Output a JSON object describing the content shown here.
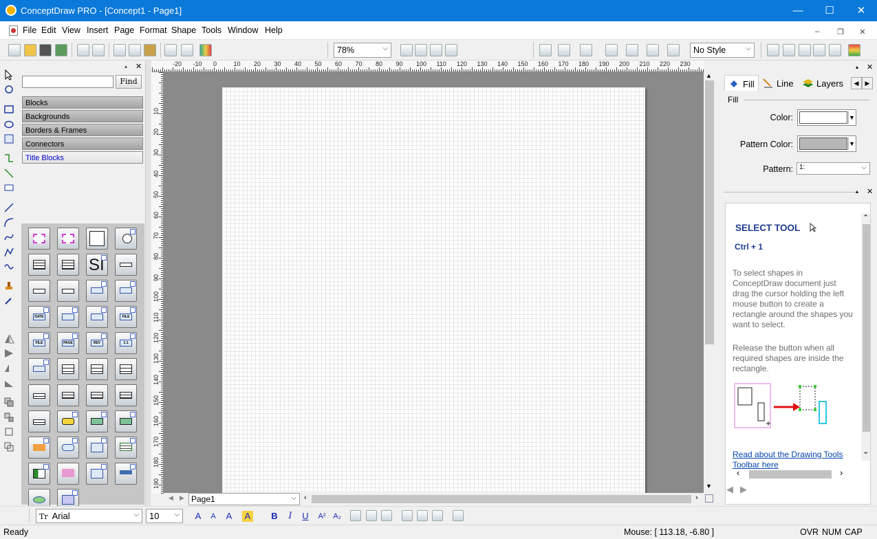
{
  "window": {
    "title": "ConceptDraw PRO - [Concept1 - Page1]"
  },
  "menu": [
    "File",
    "Edit",
    "View",
    "Insert",
    "Page",
    "Format",
    "Shape",
    "Tools",
    "Window",
    "Help"
  ],
  "toolbar": {
    "zoom": "78%",
    "style": "No Style"
  },
  "library": {
    "find_label": "Find",
    "search_value": "",
    "categories": [
      "Blocks",
      "Backgrounds",
      "Borders & Frames",
      "Connectors",
      "Title Blocks"
    ],
    "active_category": "Title Blocks",
    "tile_texts": [
      "SI",
      "DATE",
      "FILE",
      "FILE",
      "PAGE",
      "REV",
      "1:1"
    ]
  },
  "ruler": {
    "unit": "mm",
    "h": [
      "-20",
      "-10",
      "0",
      "10",
      "20",
      "30",
      "40",
      "50",
      "60",
      "70",
      "80",
      "90",
      "100",
      "110",
      "120",
      "130",
      "140",
      "150",
      "160",
      "170",
      "180",
      "190",
      "200",
      "210",
      "220",
      "230"
    ],
    "v": [
      "10",
      "20",
      "30",
      "40",
      "50",
      "60",
      "70",
      "80",
      "90",
      "100",
      "110",
      "120",
      "130",
      "140",
      "150",
      "160",
      "170",
      "180",
      "190"
    ]
  },
  "page_tab": "Page1",
  "properties": {
    "tabs": [
      "Fill",
      "Line",
      "Layers"
    ],
    "section": "Fill",
    "color_label": "Color:",
    "pattern_color_label": "Pattern Color:",
    "pattern_label": "Pattern:",
    "pattern_value": "1:",
    "color": "#ffffff",
    "pattern_color": "#b7b7b7"
  },
  "help": {
    "title": "SELECT TOOL",
    "shortcut": "Ctrl + 1",
    "p1": "To select shapes in ConceptDraw document just drag the cursor holding the left mouse button to create a rectangle around the shapes you want to select.",
    "p2": "Release the button when all required shapes are inside the rectangle.",
    "link": "Read about the Drawing Tools Toolbar here"
  },
  "font": {
    "name": "Arial",
    "size": "10",
    "glyph": "Tr"
  },
  "format_buttons": [
    "B",
    "I",
    "U",
    "A²",
    "A₂"
  ],
  "status": {
    "left": "Ready",
    "mouse": "Mouse: [ 113.18, -6.80 ]",
    "ovr": "OVR",
    "num": "NUM",
    "cap": "CAP"
  },
  "colors": {
    "titlebar": "#0b79d9",
    "link": "#0645ad",
    "help_title": "#1f3b8f"
  }
}
